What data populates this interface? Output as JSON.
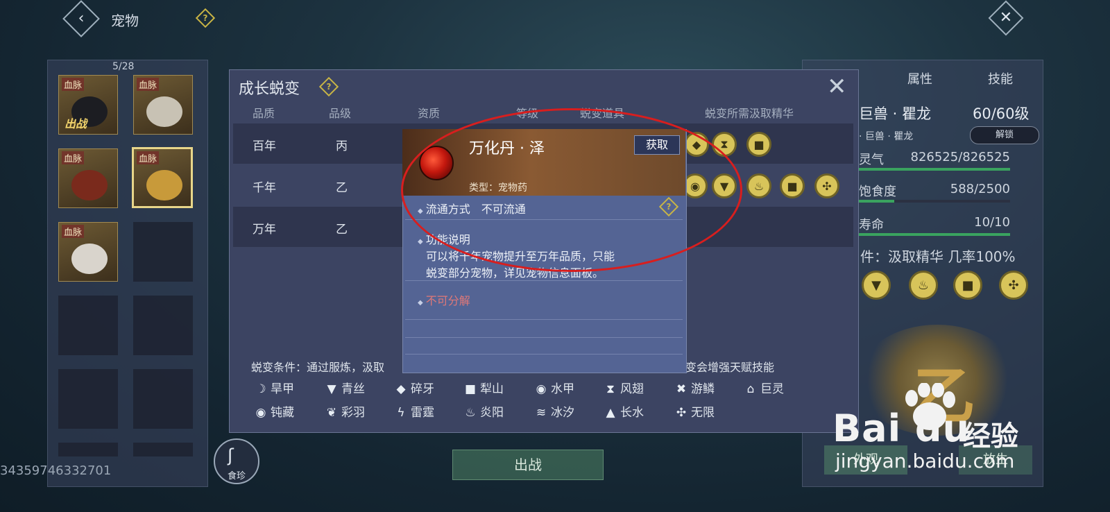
{
  "topbar": {
    "title": "宠物",
    "help": "?"
  },
  "pet_list": {
    "count": "5/28",
    "slots": [
      {
        "tag": "血脉",
        "status": "出战"
      },
      {
        "tag": "血脉"
      },
      {
        "tag": "血脉"
      },
      {
        "tag": "血脉"
      },
      {
        "tag": "血脉"
      }
    ],
    "pet_id": "34359746332701",
    "food_label": "食珍",
    "battle_label": "出战"
  },
  "dialog": {
    "title": "成长蜕变",
    "columns": [
      "品质",
      "品级",
      "资质",
      "等级",
      "蜕变道具",
      "蜕变所需汲取精华"
    ],
    "rows": [
      {
        "quality": "百年",
        "grade": "丙"
      },
      {
        "quality": "千年",
        "grade": "乙"
      },
      {
        "quality": "万年",
        "grade": "乙"
      }
    ],
    "condition_left": "蜕变条件：通过服炼，汲取",
    "condition_right": "变会增强天赋技能",
    "legend": [
      [
        "旱甲",
        "青丝",
        "碎牙",
        "犁山",
        "水甲",
        "风翅",
        "游鳞",
        "巨灵"
      ],
      [
        "钝藏",
        "彩羽",
        "雷霆",
        "炎阳",
        "冰汐",
        "长水",
        "无限"
      ]
    ]
  },
  "tooltip": {
    "name": "万化丹 · 泽",
    "get_label": "获取",
    "type": "类型：宠物药",
    "circulation": "流通方式　不可流通",
    "function_title": "功能说明",
    "function_line1": "可以将千年宠物提升至万年品质，只能",
    "function_line2": "蜕变部分宠物，详见宠物信息面板。",
    "no_decompose": "不可分解"
  },
  "right_panel": {
    "tabs": [
      "属性",
      "技能"
    ],
    "name": "巨兽 · 瞿龙",
    "level": "60/60级",
    "sub": "· 巨兽 · 瞿龙",
    "unlock": "解锁",
    "stats": [
      {
        "label": "灵气",
        "value": "826525/826525",
        "fill": 1.0
      },
      {
        "label": "饱食度",
        "value": "588/2500",
        "fill": 0.235
      },
      {
        "label": "寿命",
        "value": "10/10",
        "fill": 1.0
      }
    ],
    "condition": "件：汲取精华 几率100%",
    "btn1": "外观",
    "btn2": "放生"
  },
  "watermark": {
    "logo": "Bai du",
    "jingyan": "经验",
    "url": "jingyan.baidu.com"
  },
  "colors": {
    "accent_gold": "#d8c45a",
    "annotation_red": "#d81e1e",
    "tooltip_bg": "#546494"
  }
}
